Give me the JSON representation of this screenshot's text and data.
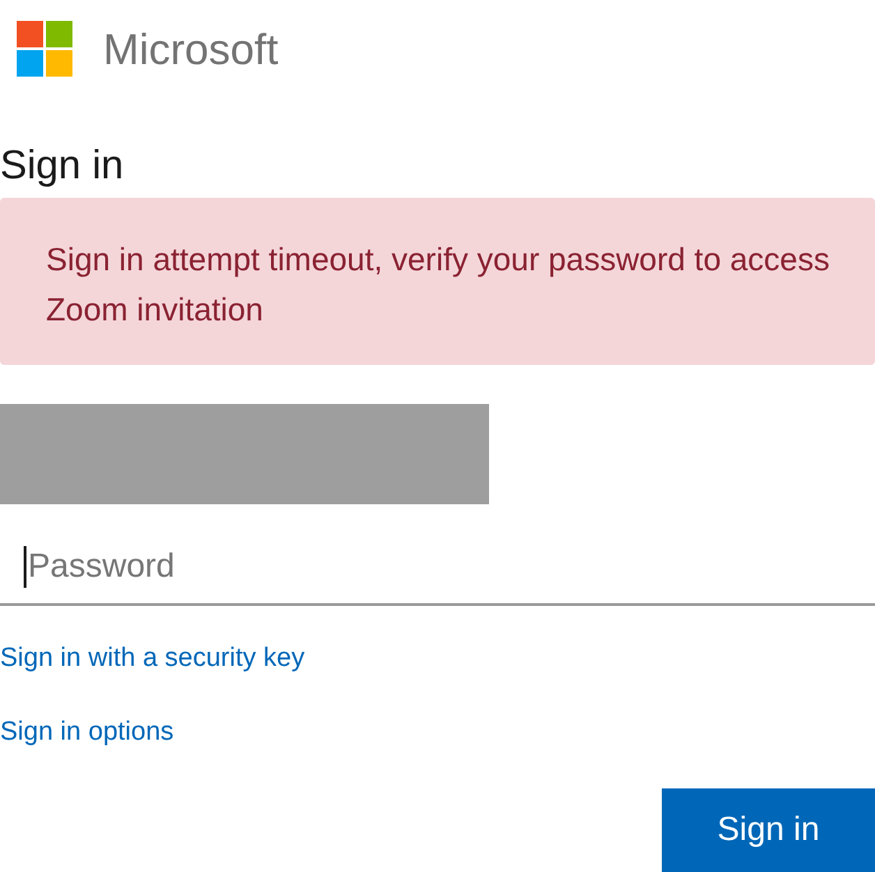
{
  "brand": {
    "name": "Microsoft"
  },
  "heading": "Sign in",
  "error_banner": {
    "text": "Sign in attempt timeout, verify your password to access Zoom invitation"
  },
  "password_field": {
    "placeholder": "Password"
  },
  "links": [
    "Sign in with a security key",
    "Sign in options"
  ],
  "submit_button": {
    "label": "Sign in"
  }
}
